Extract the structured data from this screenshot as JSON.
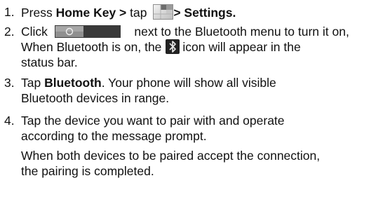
{
  "steps": [
    {
      "number": "1.",
      "press": "Press ",
      "home_key": "Home Key >",
      "tap": " tap ",
      "settings": "> Settings."
    },
    {
      "number": "2.",
      "click": "Click",
      "after_toggle": "next to the Bluetooth menu to turn it on,",
      "line2a": "When Bluetooth is on, the",
      "line2b": "icon will appear in the",
      "line3": "status bar."
    },
    {
      "number": "3.",
      "tap": "Tap ",
      "bluetooth": "Bluetooth",
      "line1_rest": ". Your phone will show all visible",
      "line2": "Bluetooth devices in range."
    },
    {
      "number": "4.",
      "line1": "Tap the device you want to pair with and operate",
      "line2": "according to the message prompt.",
      "note_line1": "When both devices to be paired accept the connection,",
      "note_line2": "the pairing is completed."
    }
  ],
  "icons": {
    "apps": "apps-launcher-icon",
    "toggle": "bluetooth-toggle-switch-icon",
    "bluetooth_status": "bluetooth-status-icon"
  }
}
